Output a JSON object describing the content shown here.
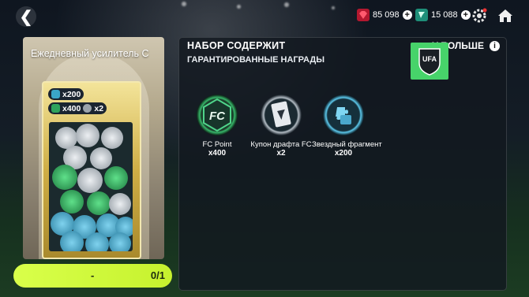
{
  "topbar": {
    "back_glyph": "❮",
    "gems": "85 098",
    "tokens": "15 088",
    "plus_glyph": "+"
  },
  "left_card": {
    "title": "Ежедневный усилитель С",
    "pack": {
      "line1": "x200",
      "line2a": "x400",
      "line2b": "x2"
    }
  },
  "panel": {
    "title": "НАБОР СОДЕРЖИТ",
    "subtitle": "ГАРАНТИРОВАННЫЕ НАГРАДЫ",
    "more_label": "У        БОЛЬШЕ",
    "info_glyph": "i",
    "ufa_text": "UFA",
    "rewards": [
      {
        "name": "FC Point",
        "qty": "x400",
        "icon": "fc-point-icon",
        "color": "#2fa35c"
      },
      {
        "name": "Купон драфта FC",
        "qty": "x2",
        "icon": "draft-coupon-icon",
        "color": "#9aa3ab"
      },
      {
        "name": "Звездный фрагмент",
        "qty": "x200",
        "icon": "star-fragment-icon",
        "color": "#3aa6c8"
      }
    ]
  },
  "bottom_bar": {
    "label": "-",
    "count": "0/1",
    "color": "#d9ff4a"
  }
}
